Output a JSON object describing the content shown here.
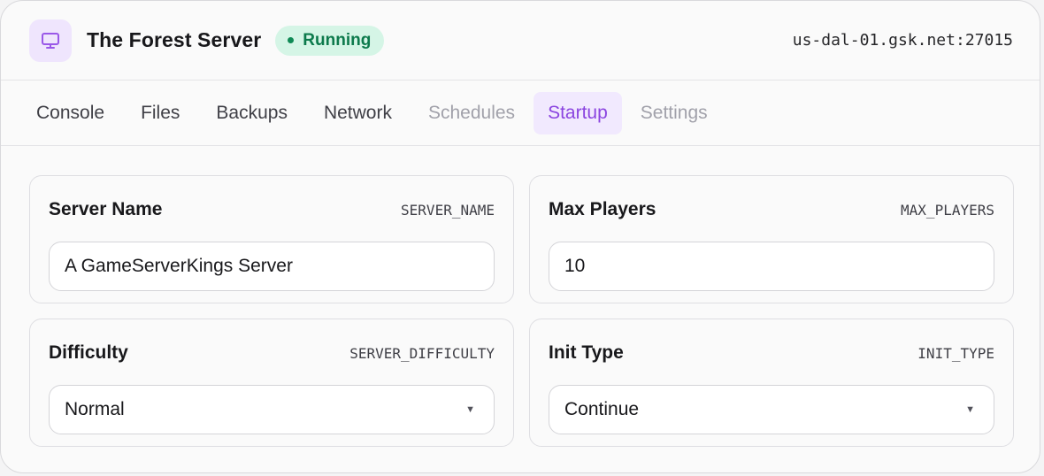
{
  "header": {
    "icon": "monitor-icon",
    "title": "The Forest Server",
    "status": "Running",
    "status_color": "#0d7a4c",
    "address": "us-dal-01.gsk.net:27015",
    "accent": "#8b45e0"
  },
  "tabs": [
    {
      "label": "Console",
      "state": "normal"
    },
    {
      "label": "Files",
      "state": "normal"
    },
    {
      "label": "Backups",
      "state": "normal"
    },
    {
      "label": "Network",
      "state": "normal"
    },
    {
      "label": "Schedules",
      "state": "disabled"
    },
    {
      "label": "Startup",
      "state": "active"
    },
    {
      "label": "Settings",
      "state": "disabled"
    }
  ],
  "variables": {
    "server_name": {
      "label": "Server Name",
      "env": "SERVER_NAME",
      "value": "A GameServerKings Server"
    },
    "max_players": {
      "label": "Max Players",
      "env": "MAX_PLAYERS",
      "value": "10"
    },
    "difficulty": {
      "label": "Difficulty",
      "env": "SERVER_DIFFICULTY",
      "value": "Normal"
    },
    "init_type": {
      "label": "Init Type",
      "env": "INIT_TYPE",
      "value": "Continue"
    }
  }
}
